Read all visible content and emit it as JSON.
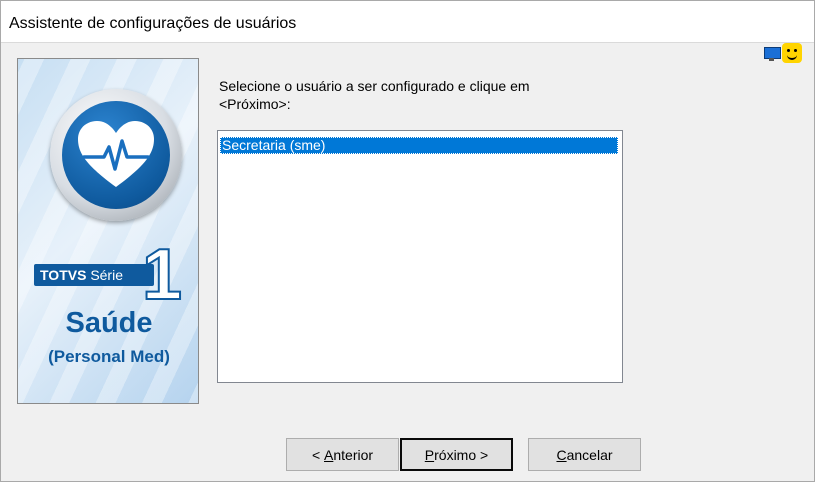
{
  "window": {
    "title": "Assistente de configurações de usuários"
  },
  "status_icons": [
    "monitor-icon",
    "smiley-icon"
  ],
  "banner": {
    "brand_bold": "TOTVS",
    "brand_series": "Série",
    "series_number": "1",
    "product": "Saúde",
    "edition": "(Personal Med)"
  },
  "instruction_line1": "Selecione o usuário a ser configurado e clique em",
  "instruction_line2": "<Próximo>:",
  "user_list": {
    "items": [
      "Secretaria (sme)"
    ],
    "selected": "Secretaria (sme)"
  },
  "buttons": {
    "back_prefix": "< ",
    "back_accel": "A",
    "back_rest": "nterior",
    "next_accel": "P",
    "next_rest": "róximo >",
    "cancel_accel": "C",
    "cancel_rest": "ancelar"
  },
  "colors": {
    "selection": "#0078d7",
    "brand_blue": "#0f5a9e"
  }
}
